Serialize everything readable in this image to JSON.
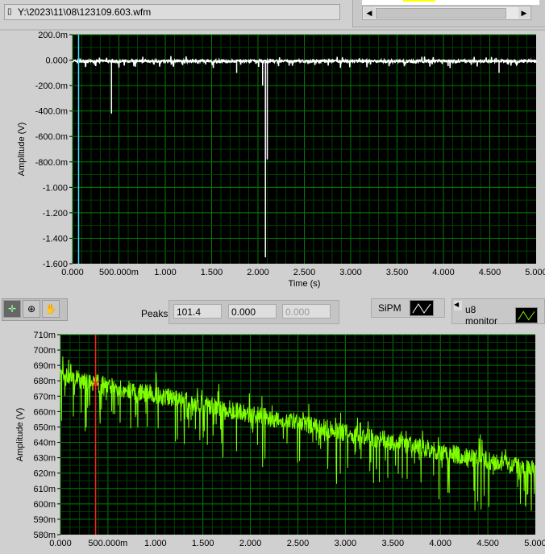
{
  "file_path": "Y:\\2023\\11\\08\\123109.603.wfm",
  "toolbar": {
    "peaks_label": "Peaks",
    "peaks_values": [
      "101.4",
      "0.000",
      "0.000"
    ]
  },
  "legends": {
    "sipm": "SiPM",
    "u8": "u8 monitor"
  },
  "colors": {
    "plot_bg": "#000000",
    "grid_major": "#008000",
    "grid_minor": "#004000",
    "trace1": "#ffffff",
    "trace2": "#7fff00",
    "cursor1": "#40e0ff",
    "cursor2": "#ff2020"
  },
  "chart_data": [
    {
      "type": "line",
      "title": "",
      "xlabel": "Time (s)",
      "ylabel": "Amplitude (V)",
      "xlim": [
        0,
        5
      ],
      "ylim": [
        -1.6,
        0.2
      ],
      "xticks": [
        "0.000",
        "500.000m",
        "1.000",
        "1.500",
        "2.000",
        "2.500",
        "3.000",
        "3.500",
        "4.000",
        "4.500",
        "5.000"
      ],
      "yticks": [
        "200.0m",
        "0.000",
        "-200.0m",
        "-400.0m",
        "-600.0m",
        "-800.0m",
        "-1.000",
        "-1.200",
        "-1.400",
        "-1.600"
      ],
      "baseline": 0.0,
      "spikes": [
        [
          0.42,
          -0.42
        ],
        [
          1.77,
          -0.1
        ],
        [
          2.05,
          -0.2
        ],
        [
          2.08,
          -1.55
        ],
        [
          2.1,
          -0.78
        ],
        [
          4.6,
          -0.1
        ]
      ],
      "cursor_x": 0.065
    },
    {
      "type": "line",
      "title": "",
      "xlabel": "",
      "ylabel": "Amplitude (V)",
      "xlim": [
        0,
        5
      ],
      "ylim": [
        0.58,
        0.71
      ],
      "xticks": [
        "0.000",
        "500.000m",
        "1.000",
        "1.500",
        "2.000",
        "2.500",
        "3.000",
        "3.500",
        "4.000",
        "4.500",
        "5.000"
      ],
      "yticks": [
        "710m",
        "700m",
        "690m",
        "680m",
        "670m",
        "660m",
        "650m",
        "640m",
        "630m",
        "620m",
        "610m",
        "600m",
        "590m",
        "580m"
      ],
      "trend_start": 0.683,
      "trend_end": 0.622,
      "noise": 0.006,
      "cursor_x": 0.37,
      "cursor_y": 0.678
    }
  ]
}
